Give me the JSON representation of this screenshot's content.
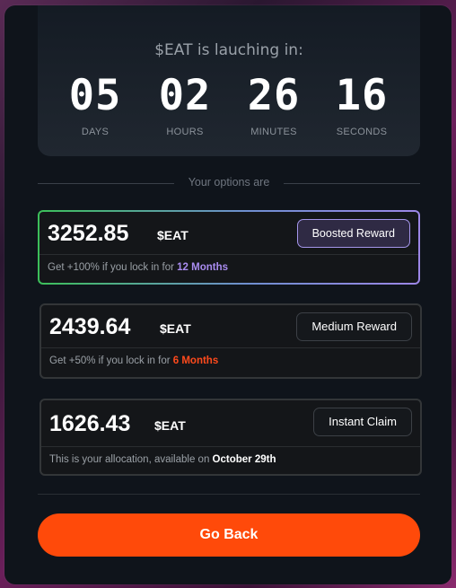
{
  "countdown": {
    "title": "$EAT is lauching in:",
    "units": [
      {
        "value": "05",
        "label": "DAYS"
      },
      {
        "value": "02",
        "label": "HOURS"
      },
      {
        "value": "26",
        "label": "MINUTES"
      },
      {
        "value": "16",
        "label": "SECONDS"
      }
    ]
  },
  "options_heading": "Your options are",
  "options": [
    {
      "amount": "3252.85",
      "unit": "$EAT",
      "button": "Boosted Reward",
      "desc_prefix": "Get +100% if you lock in for ",
      "desc_highlight": "12 Months",
      "highlight_color": "#a98cf0"
    },
    {
      "amount": "2439.64",
      "unit": "$EAT",
      "button": "Medium Reward",
      "desc_prefix": "Get +50% if you lock in for ",
      "desc_highlight": "6 Months",
      "highlight_color": "#ff4a1c"
    },
    {
      "amount": "1626.43",
      "unit": "$EAT",
      "button": "Instant Claim",
      "desc_prefix": "This is your allocation, available on ",
      "desc_highlight": "October 29th",
      "highlight_color": "#ffffff"
    }
  ],
  "go_back_label": "Go Back",
  "colors": {
    "accent": "#ff4a0a",
    "boosted_border_start": "#3cbf5a",
    "boosted_border_end": "#9c86e6"
  }
}
